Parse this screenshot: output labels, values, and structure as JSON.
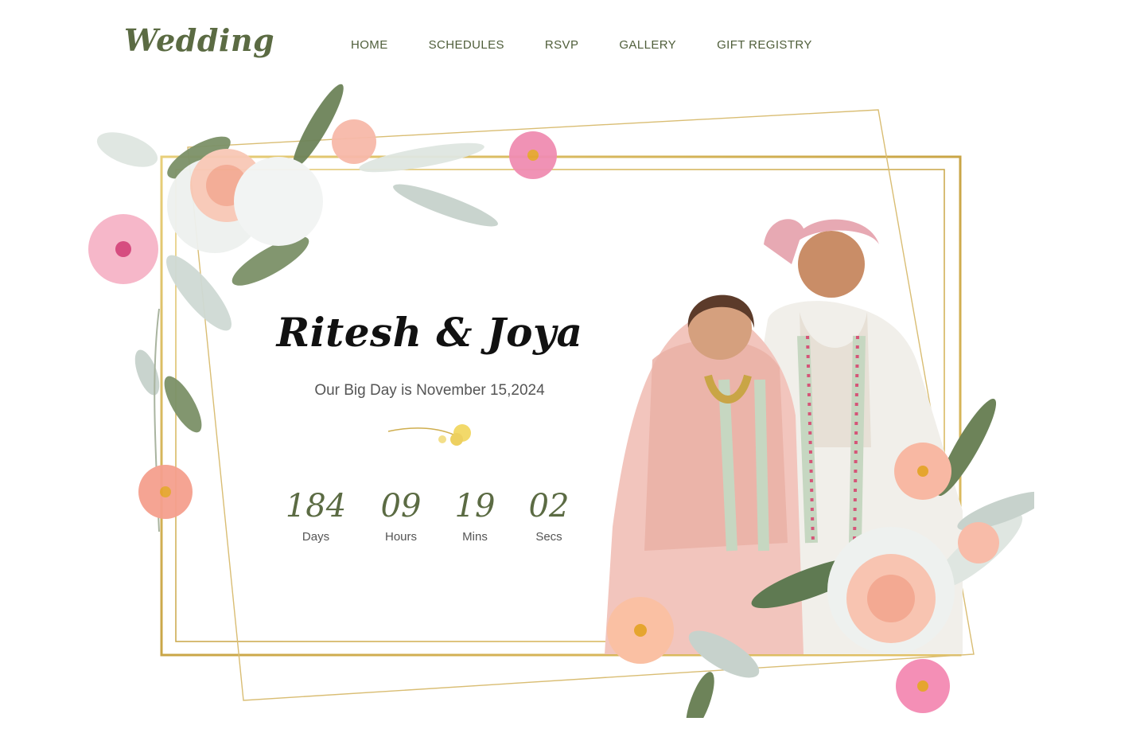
{
  "header": {
    "logo": "Wedding",
    "nav": [
      "HOME",
      "SCHEDULES",
      "RSVP",
      "GALLERY",
      "GIFT REGISTRY"
    ]
  },
  "hero": {
    "names": "Ritesh & Joya",
    "subtitle": "Our Big Day is November 15,2024",
    "countdown": [
      {
        "value": "184",
        "label": "Days"
      },
      {
        "value": "09",
        "label": "Hours"
      },
      {
        "value": "19",
        "label": "Mins"
      },
      {
        "value": "02",
        "label": "Secs"
      }
    ]
  },
  "colors": {
    "accent": "#5b6b43",
    "gold": "#c9a546",
    "rose": "#f4b1a4",
    "pink": "#ee7ea7"
  },
  "icons": [
    "floral-top-left-icon",
    "floral-bottom-right-icon",
    "gold-flower-divider-icon"
  ]
}
